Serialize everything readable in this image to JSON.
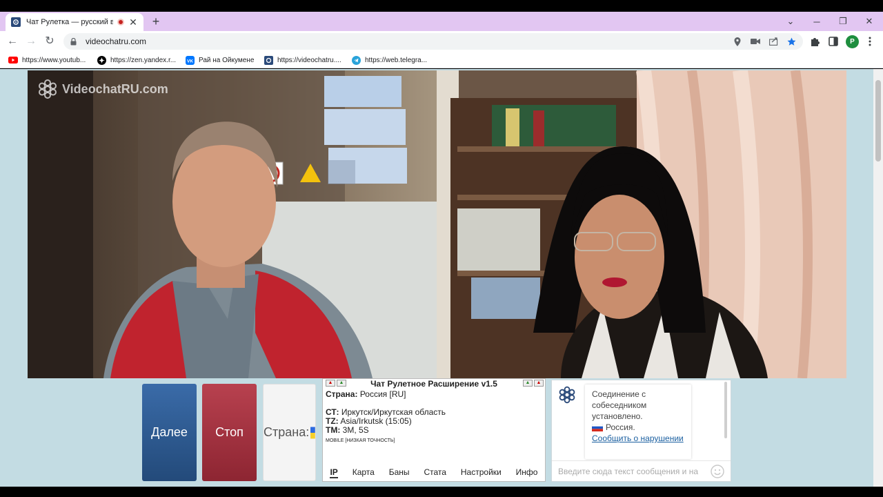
{
  "browser": {
    "tab_title": "Чат Рулетка — русский вид",
    "url": "videochatru.com",
    "bookmarks": [
      {
        "label": "https://www.youtub...",
        "icon": "youtube-icon"
      },
      {
        "label": "https://zen.yandex.r...",
        "icon": "zen-icon"
      },
      {
        "label": "Рай на Ойкумене",
        "icon": "vk-icon"
      },
      {
        "label": "https://videochatru....",
        "icon": "videochatru-icon"
      },
      {
        "label": "https://web.telegra...",
        "icon": "telegram-icon"
      }
    ],
    "profile_initial": "P"
  },
  "site": {
    "logo_text": "VideochatRU.com"
  },
  "controls": {
    "next_label": "Далее",
    "stop_label": "Стоп",
    "country_label": "Страна:"
  },
  "extension": {
    "title": "Чат Рулетное Расширение v1.5",
    "country_key": "Страна:",
    "country_value": "Россия [RU]",
    "city_key": "СТ:",
    "city_value": "Иркутск/Иркутская область",
    "tz_key": "TZ:",
    "tz_value": "Asia/Irkutsk (15:05)",
    "tm_key": "ТМ:",
    "tm_value": "3М, 5S",
    "mobile_note": "MOBILE [НИЗКАЯ ТОЧНОСТЬ]",
    "tabs": [
      "IP",
      "Карта",
      "Баны",
      "Стата",
      "Настройки",
      "Инфо"
    ]
  },
  "chat": {
    "message": "Соединение с собеседником установлено.",
    "country": "Россия.",
    "report_link": "Сообщить о нарушении",
    "input_placeholder": "Введите сюда текст сообщения и на"
  },
  "colors": {
    "next_button": "#2f5d96",
    "stop_button": "#a33340",
    "tab_strip": "#e2c6f2",
    "page_bg": "#c3dce3"
  }
}
